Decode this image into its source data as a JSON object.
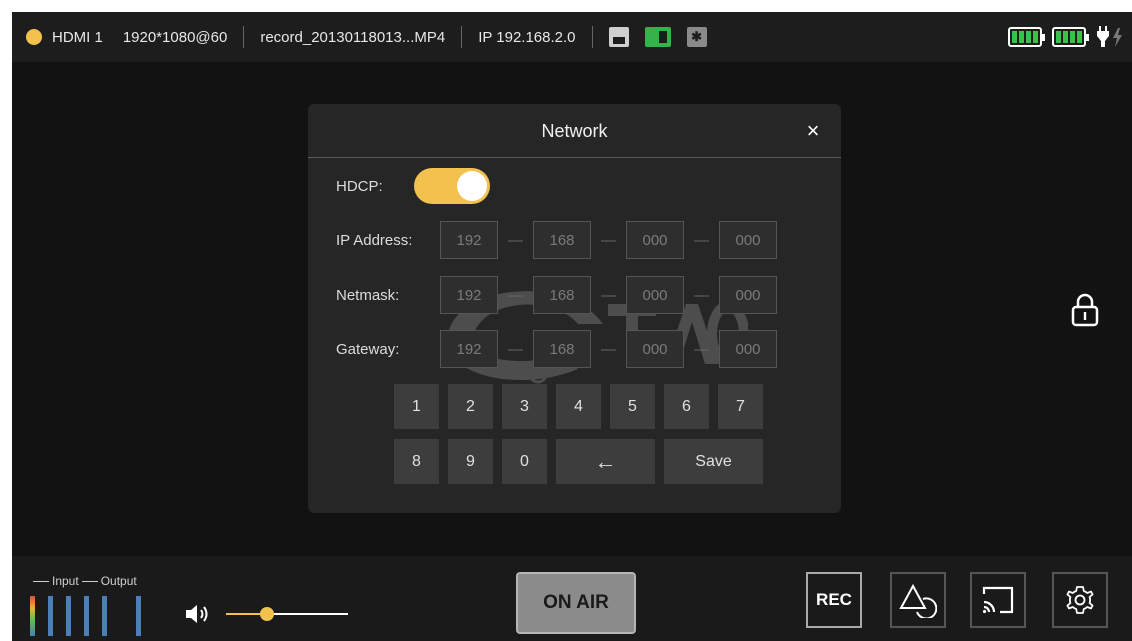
{
  "status_bar": {
    "source": "HDMI 1",
    "resolution": "1920*1080@60",
    "record_file": "record_20130118013...MP4",
    "ip": "IP 192.168.2.0",
    "icons": [
      "network-icon",
      "sd-card-icon",
      "bluetooth-icon",
      "battery-icon",
      "battery-icon",
      "power-plug-icon"
    ],
    "bluetooth_glyph": "✱",
    "battery_level_1": 1.0,
    "battery_level_2": 1.0
  },
  "dialog": {
    "title": "Network",
    "close_label": "×",
    "hdcp": {
      "label": "HDCP:",
      "enabled": true
    },
    "ip_address": {
      "label": "IP Address:",
      "octets": [
        "192",
        "168",
        "000",
        "000"
      ]
    },
    "netmask": {
      "label": "Netmask:",
      "octets": [
        "192",
        "168",
        "000",
        "000"
      ]
    },
    "gateway": {
      "label": "Gateway:",
      "octets": [
        "192",
        "168",
        "000",
        "000"
      ]
    },
    "separator": "—",
    "keypad": [
      "1",
      "2",
      "3",
      "4",
      "5",
      "6",
      "7",
      "8",
      "9",
      "0"
    ],
    "backspace_label": "←",
    "save_label": "Save"
  },
  "bottom_bar": {
    "input_label": "Input",
    "output_label": "Output",
    "volume_level": 0.34,
    "on_air_label": "ON AIR",
    "rec_label": "REC"
  },
  "colors": {
    "accent": "#f2c14e",
    "green": "#33b34a",
    "background": "#121212"
  }
}
